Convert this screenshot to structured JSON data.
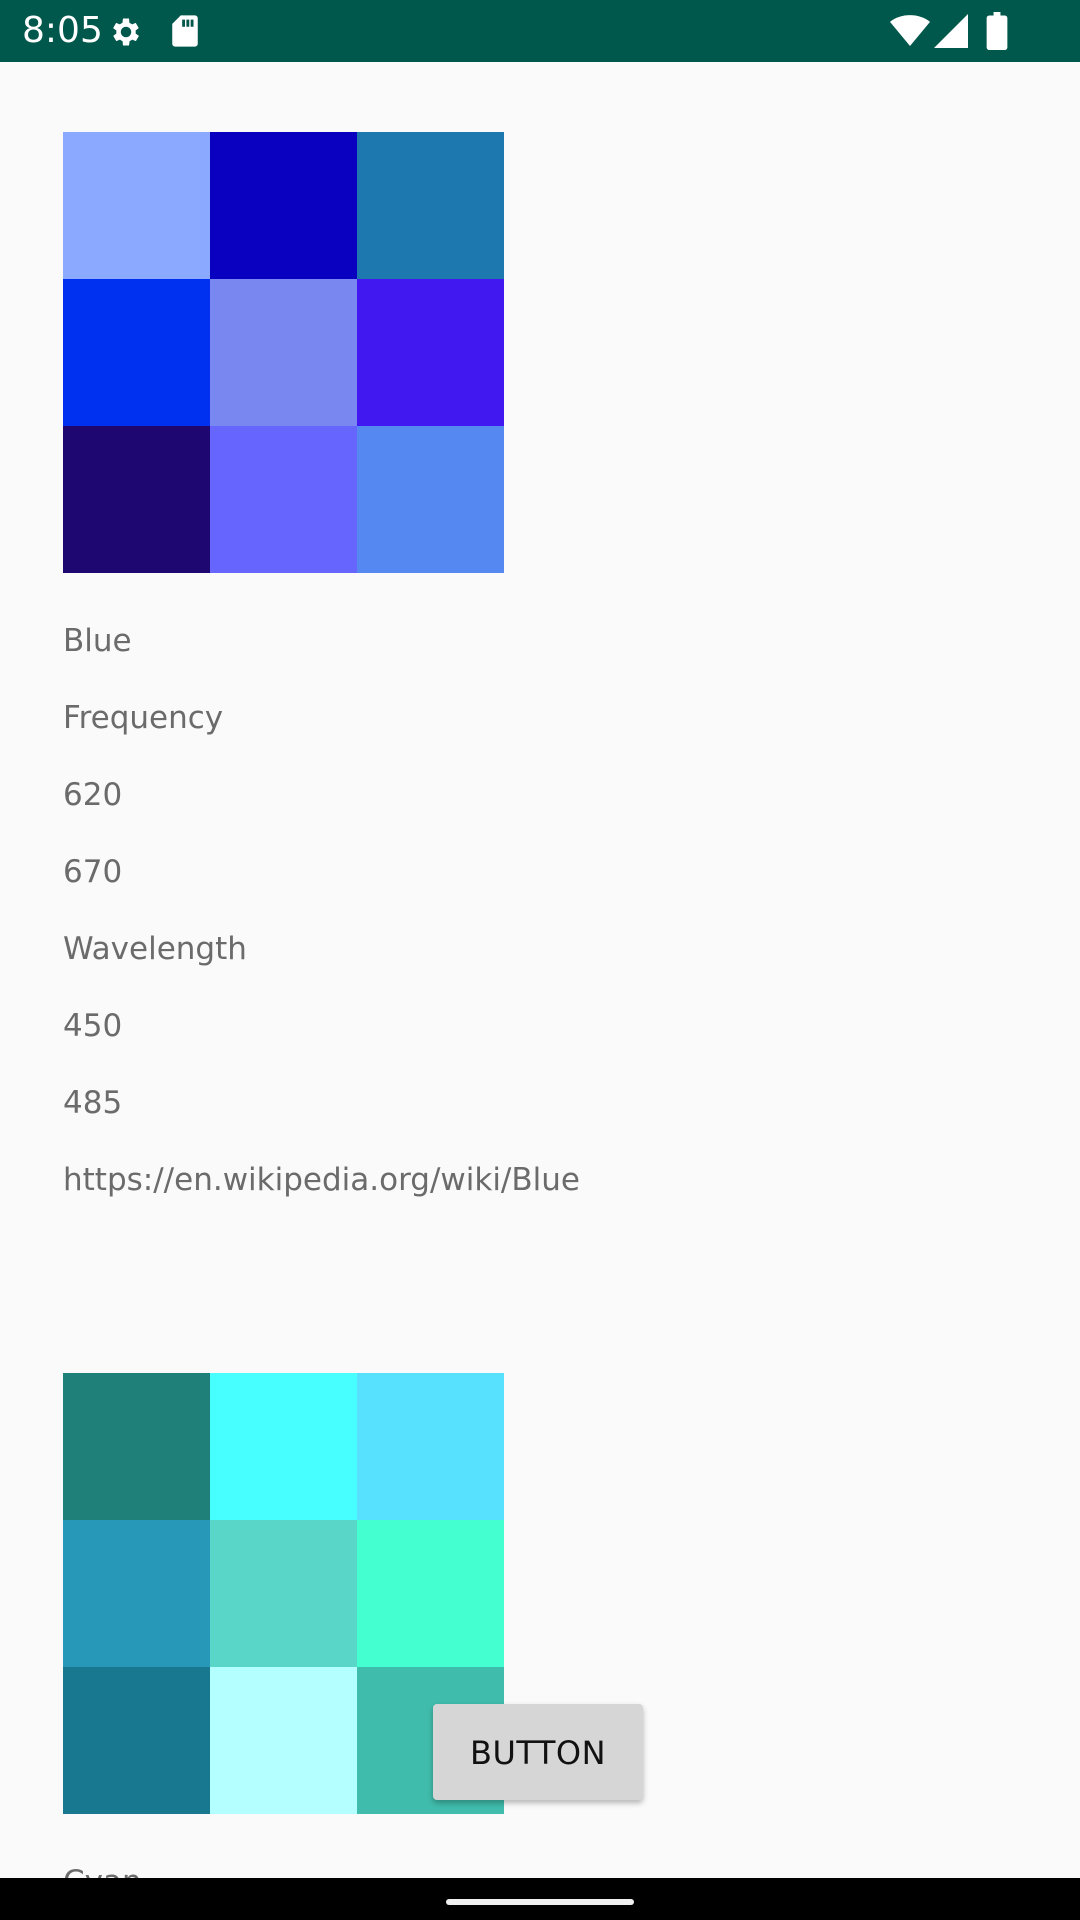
{
  "status_bar": {
    "time": "8:05",
    "icons": [
      "gear-icon",
      "sd-card-icon",
      "wifi-icon",
      "cellular-signal-icon",
      "battery-icon"
    ],
    "background": "#00574b"
  },
  "colors": [
    {
      "name": "Blue",
      "swatches": [
        "#8aa9ff",
        "#0a00c0",
        "#1e78b0",
        "#0030f0",
        "#7888f0",
        "#4218f0",
        "#1e0770",
        "#6666ff",
        "#5588f0"
      ],
      "frequency_label": "Frequency",
      "frequency_min": "620",
      "frequency_max": "670",
      "wavelength_label": "Wavelength",
      "wavelength_min": "450",
      "wavelength_max": "485",
      "link": "https://en.wikipedia.org/wiki/Blue"
    },
    {
      "name": "Cyan",
      "swatches": [
        "#1e8078",
        "#48ffff",
        "#58e0ff",
        "#2898b8",
        "#5ad6c8",
        "#44ffd0",
        "#177890",
        "#b4ffff",
        "#40bcac"
      ]
    }
  ],
  "button": {
    "label": "BUTTON"
  },
  "nav_bar": {
    "handle": "home-handle"
  }
}
